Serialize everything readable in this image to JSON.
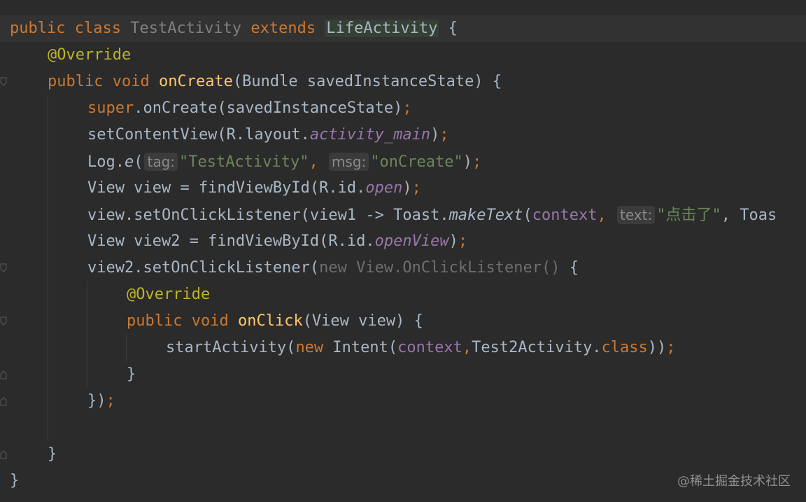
{
  "code": {
    "line1": {
      "t1": "public",
      "t2": "class",
      "t3": "TestActivity",
      "t4": "extends",
      "t5": "LifeActivity",
      "t6": " {"
    },
    "line2": {
      "t1": "@Override"
    },
    "line3": {
      "t1": "public",
      "t2": "void",
      "t3": "onCreate",
      "t4": "(Bundle savedInstanceState) {"
    },
    "line4": {
      "t1": "super",
      "t2": ".onCreate(savedInstanceState)",
      "t3": ";"
    },
    "line5": {
      "t1": "setContentView(R.layout.",
      "t2": "activity_main",
      "t3": ")",
      "t4": ";"
    },
    "line6": {
      "t1": "Log.",
      "t2": "e",
      "t3": "(",
      "hint1": "tag:",
      "t4": "\"TestActivity\"",
      "t5": ",",
      "hint2": "msg:",
      "t6": "\"onCreate\"",
      "t7": ")",
      "t8": ";"
    },
    "line7": {
      "t1": "View view = findViewById(R.id.",
      "t2": "open",
      "t3": ")",
      "t4": ";"
    },
    "line8": {
      "t1": "view.setOnClickListener(view1 -> Toast.",
      "t2": "makeText",
      "t3": "(",
      "t4": "context",
      "t5": ",",
      "hint1": "text:",
      "t6": "\"点击了\"",
      "t7": ", Toas"
    },
    "line9": {
      "t1": "View view2 = findViewById(R.id.",
      "t2": "openView",
      "t3": ")",
      "t4": ";"
    },
    "line10": {
      "t1": "view2.setOnClickListener(",
      "t2": "new View.OnClickListener()",
      "t3": " {"
    },
    "line11": {
      "t1": "@Override"
    },
    "line12": {
      "t1": "public",
      "t2": "void",
      "t3": "onClick",
      "t4": "(View view) {"
    },
    "line13": {
      "t1": "startActivity(",
      "t2": "new",
      "t3": " Intent(",
      "t4": "context",
      "t5": ",",
      "t6": "Test2Activity.",
      "t7": "class",
      "t8": "))",
      "t9": ";"
    },
    "line14": {
      "t1": "}"
    },
    "line15": {
      "t1": "})",
      "t2": ";"
    },
    "line17": {
      "t1": "}"
    },
    "line18": {
      "t1": "}"
    }
  },
  "watermark": "@稀土掘金技术社区",
  "colors": {
    "background": "#2b2b2b",
    "keyword": "#cc7832",
    "annotation": "#bbb529",
    "method": "#ffc66d",
    "field": "#9876aa",
    "string": "#6a8759",
    "text": "#a9b7c6"
  }
}
